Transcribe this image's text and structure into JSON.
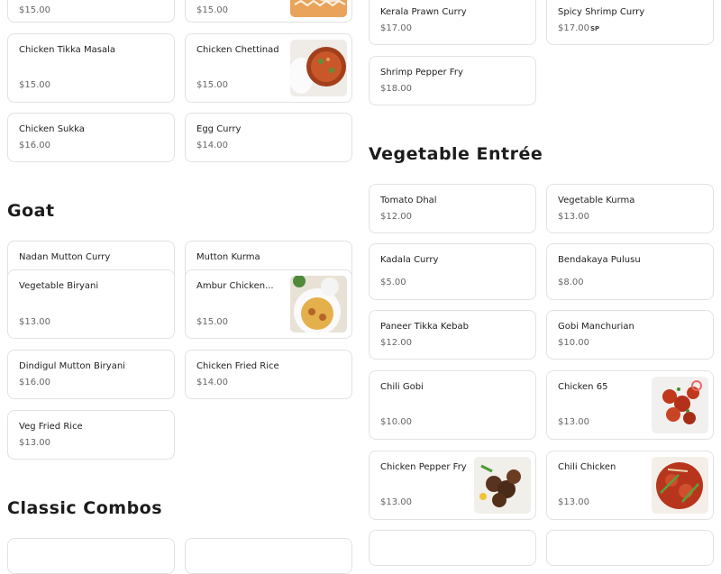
{
  "sections": {
    "goat": "Goat",
    "vegetable_entree": "Vegetable Entrée",
    "classic_combos": "Classic Combos"
  },
  "items": {
    "top_left_1": {
      "price": "$15.00"
    },
    "top_left_2": {
      "price": "$15.00"
    },
    "chicken_tikka_masala": {
      "name": "Chicken Tikka Masala",
      "price": "$15.00"
    },
    "chicken_chettinad": {
      "name": "Chicken Chettinad",
      "price": "$15.00"
    },
    "chicken_sukka": {
      "name": "Chicken Sukka",
      "price": "$16.00"
    },
    "egg_curry": {
      "name": "Egg Curry",
      "price": "$14.00"
    },
    "nadan_mutton_curry": {
      "name": "Nadan Mutton Curry"
    },
    "mutton_kurma": {
      "name": "Mutton Kurma"
    },
    "vegetable_biryani": {
      "name": "Vegetable Biryani",
      "price": "$13.00"
    },
    "ambur_chicken": {
      "name": "Ambur Chicken...",
      "price": "$15.00"
    },
    "dindigul_mutton_biryani": {
      "name": "Dindigul Mutton Biryani",
      "price": "$16.00"
    },
    "chicken_fried_rice": {
      "name": "Chicken Fried Rice",
      "price": "$14.00"
    },
    "veg_fried_rice": {
      "name": "Veg Fried Rice",
      "price": "$13.00"
    },
    "kerala_prawn_curry": {
      "name": "Kerala Prawn Curry",
      "price": "$17.00"
    },
    "spicy_shrimp_curry": {
      "name": "Spicy Shrimp Curry",
      "price": "$17.00",
      "badge": "SP"
    },
    "shrimp_pepper_fry": {
      "name": "Shrimp Pepper Fry",
      "price": "$18.00"
    },
    "tomato_dhal": {
      "name": "Tomato Dhal",
      "price": "$12.00"
    },
    "vegetable_kurma": {
      "name": "Vegetable Kurma",
      "price": "$13.00"
    },
    "kadala_curry": {
      "name": "Kadala Curry",
      "price": "$5.00"
    },
    "bendakaya_pulusu": {
      "name": "Bendakaya Pulusu",
      "price": "$8.00"
    },
    "paneer_tikka_kebab": {
      "name": "Paneer Tikka Kebab",
      "price": "$12.00"
    },
    "gobi_manchurian": {
      "name": "Gobi Manchurian",
      "price": "$10.00"
    },
    "chili_gobi": {
      "name": "Chili Gobi",
      "price": "$10.00"
    },
    "chicken_65": {
      "name": "Chicken 65",
      "price": "$13.00"
    },
    "chicken_pepper_fry": {
      "name": "Chicken Pepper Fry",
      "price": "$13.00"
    },
    "chili_chicken": {
      "name": "Chili Chicken",
      "price": "$13.00"
    }
  },
  "colors": {
    "card_border": "#e2e2e2",
    "price_text": "#666666",
    "title_text": "#1c1c1c"
  }
}
